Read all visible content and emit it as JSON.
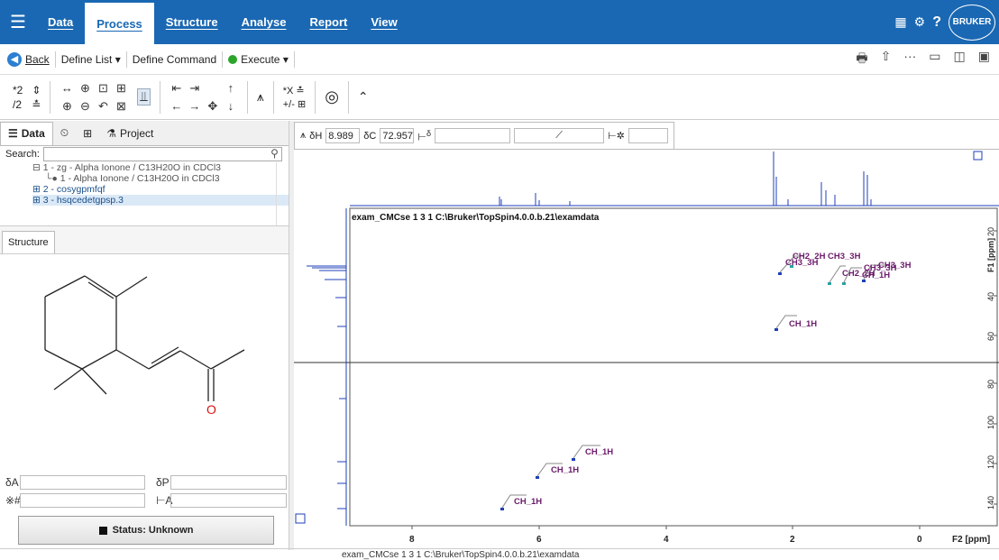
{
  "menu": {
    "items": [
      {
        "label": "Data",
        "active": false
      },
      {
        "label": "Process",
        "active": true
      },
      {
        "label": "Structure",
        "active": false
      },
      {
        "label": "Analyse",
        "active": false
      },
      {
        "label": "Report",
        "active": false
      },
      {
        "label": "View",
        "active": false
      }
    ],
    "help": "?",
    "logo": "BRUKER"
  },
  "toolbar1": {
    "back": "Back",
    "define_list": "Define List ▾",
    "define_command": "Define Command",
    "execute": "Execute ▾",
    "more": "···"
  },
  "toolbar2": {
    "scale_up": "*2",
    "scale_down": "/2",
    "x_label": "*X",
    "pm_label": "+/-"
  },
  "left_panel": {
    "tabs": [
      "Data",
      "Project"
    ],
    "search_label": "Search:",
    "tree": [
      "⊟ 1 - zg - Alpha Ionone / C13H20O in CDCl3",
      "└● 1 - Alpha Ionone / C13H20O in CDCl3",
      "⊞ 2 - cosygpmfqf",
      "⊞ 3 - hsqcedetgpsp.3"
    ],
    "structure_tab": "Structure",
    "oxygen_label": "O",
    "status_label": "Status: Unknown",
    "prop_symbols": [
      "δA",
      "δP",
      "※#",
      "⊢A"
    ]
  },
  "spectrum": {
    "delta_h_label": "δH",
    "delta_h_value": "8.989",
    "delta_c_label": "δC",
    "delta_c_value": "72.957",
    "delta_sym": "δ",
    "title": "exam_CMCse 1 3 1 C:\\Bruker\\TopSpin4.0.0.b.21\\examdata",
    "x_axis_label": "F2 [ppm]",
    "x_ticks": [
      "8",
      "6",
      "4",
      "2",
      "0"
    ],
    "y_axis_label": "F1 [ppm]",
    "y_ticks": [
      "20",
      "40",
      "60",
      "80",
      "100",
      "120",
      "140"
    ],
    "peak_labels": [
      "CH2_2H",
      "CH3_3H",
      "CH3_3H",
      "CH3_3H",
      "CH3_3H",
      "CH2_2H",
      "CH_1H",
      "CH_1H",
      "CH_1H",
      "CH_1H",
      "CH_1H"
    ]
  },
  "statusbar": {
    "path": "exam_CMCse 1 3 1 C:\\Bruker\\TopSpin4.0.0.b.21\\examdata"
  },
  "colors": {
    "menubar": "#1a68b3",
    "peak": "#1f3fb8",
    "label": "#6b1a6b"
  }
}
